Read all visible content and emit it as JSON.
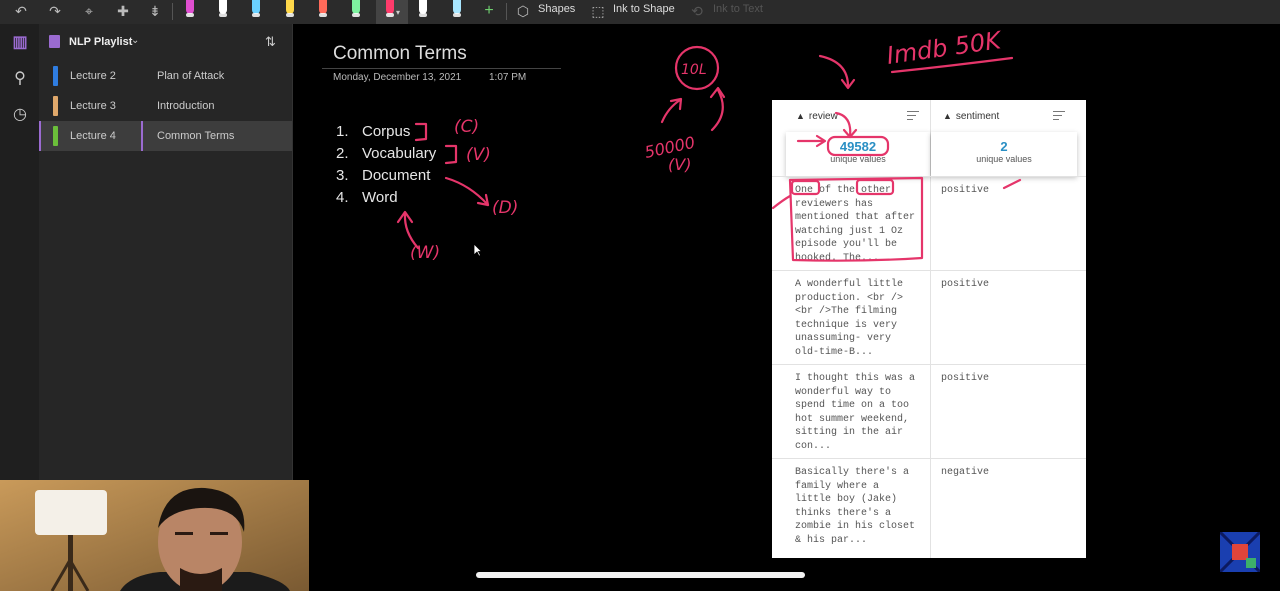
{
  "toolbar": {
    "shapes_label": "Shapes",
    "ink_to_shape_label": "Ink to Shape",
    "ink_to_text_label": "Ink to Text",
    "pens": [
      {
        "color": "#e04fd0"
      },
      {
        "color": "#ffffff"
      },
      {
        "color": "#6ad1ff"
      },
      {
        "color": "#ffd84a"
      },
      {
        "color": "#ff6a5a"
      },
      {
        "color": "#7ef2a0"
      },
      {
        "color": "#ff3b6b"
      },
      {
        "color": "#ffffff"
      },
      {
        "color": "#a8e6ff"
      }
    ]
  },
  "notebook": {
    "name": "NLP Playlist",
    "sections": [
      {
        "label": "Lecture 2",
        "color": "#2f7de1"
      },
      {
        "label": "Lecture 3",
        "color": "#e0a86b"
      },
      {
        "label": "Lecture 4",
        "color": "#6bbf3a"
      }
    ],
    "pages": [
      {
        "label": "Plan of Attack"
      },
      {
        "label": "Introduction"
      },
      {
        "label": "Common Terms"
      }
    ]
  },
  "page": {
    "title": "Common Terms",
    "date": "Monday, December 13, 2021",
    "time": "1:07 PM",
    "terms": [
      {
        "num": "1.",
        "text": "Corpus"
      },
      {
        "num": "2.",
        "text": "Vocabulary"
      },
      {
        "num": "3.",
        "text": "Document"
      },
      {
        "num": "4.",
        "text": "Word"
      }
    ]
  },
  "dataset": {
    "columns": [
      {
        "name": "review",
        "unique_count": "49582",
        "unique_label": "unique values"
      },
      {
        "name": "sentiment",
        "unique_count": "2",
        "unique_label": "unique values"
      }
    ],
    "rows": [
      {
        "review": "One of the other\nreviewers has\nmentioned that after\nwatching just 1 Oz\nepisode you'll be\nhooked. The...",
        "sentiment": "positive"
      },
      {
        "review": "A wonderful little\nproduction. <br />\n<br />The filming\ntechnique is very\nunassuming- very\nold-time-B...",
        "sentiment": "positive"
      },
      {
        "review": "I thought this was a\nwonderful way to\nspend time on a too\nhot summer weekend,\nsitting in the air\ncon...",
        "sentiment": "positive"
      },
      {
        "review": "Basically there's a\nfamily where a\nlittle boy (Jake)\nthinks there's a\nzombie in his closet\n& his par...",
        "sentiment": "negative"
      }
    ]
  },
  "ink": {
    "imdb": "Imdb 50K",
    "ten_l": "10L",
    "fifty_k": "50000",
    "v_paren": "(V)",
    "c_note": "(C)",
    "v_note": "(V)",
    "d_note": "(D)",
    "w_note": "(W)",
    "ink_color": "#e5356a"
  }
}
